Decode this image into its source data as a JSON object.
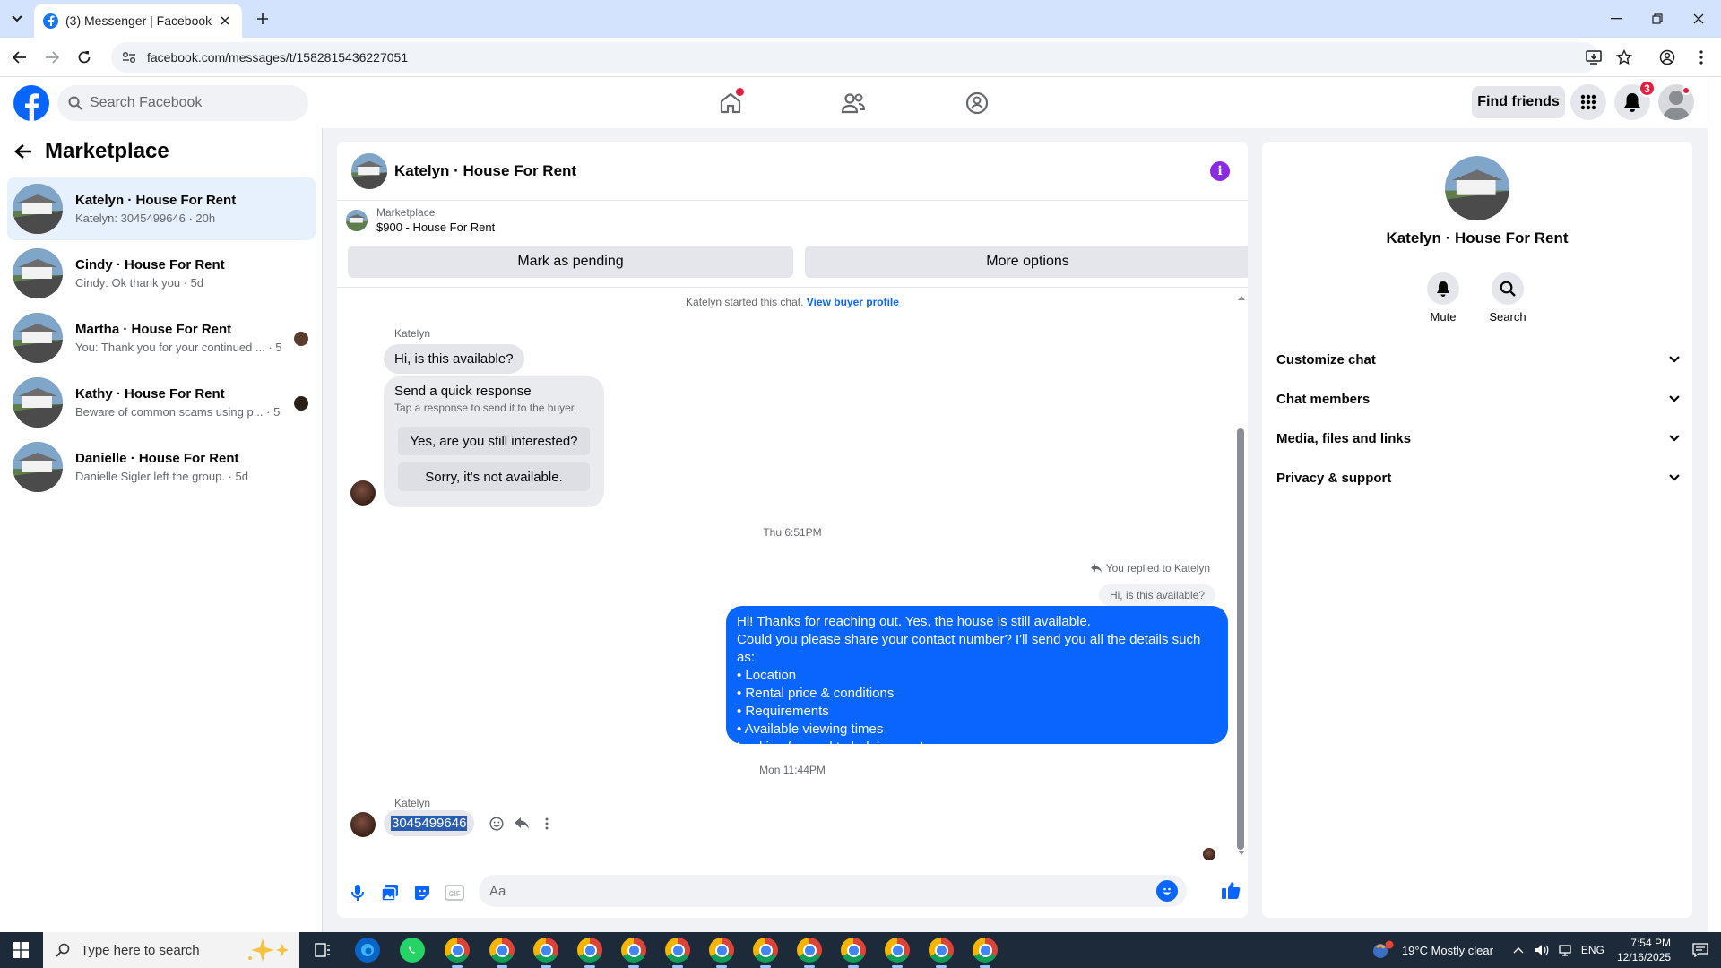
{
  "browser": {
    "tab_title": "(3) Messenger | Facebook",
    "url": "facebook.com/messages/t/1582815436227051"
  },
  "fb": {
    "search_placeholder": "Search Facebook",
    "find_friends": "Find friends",
    "notification_count": "3"
  },
  "left": {
    "title": "Marketplace",
    "conversations": [
      {
        "name": "Katelyn · House For Rent",
        "preview": "Katelyn: 3045499646 · 20h"
      },
      {
        "name": "Cindy · House For Rent",
        "preview": "Cindy: Ok thank you · 5d"
      },
      {
        "name": "Martha · House For Rent",
        "preview": "You: Thank you for your continued ... · 5d"
      },
      {
        "name": "Kathy · House For Rent",
        "preview": "Beware of common scams using p... · 5d"
      },
      {
        "name": "Danielle · House For Rent",
        "preview": "Danielle Sigler left the group. · 5d"
      }
    ]
  },
  "chat": {
    "title": "Katelyn · House For Rent",
    "listing_label": "Marketplace",
    "listing_title": "$900 - House For Rent",
    "mark_pending": "Mark as pending",
    "more_options": "More options",
    "started_text": "Katelyn started this chat.",
    "view_buyer": "View buyer profile",
    "sender": "Katelyn",
    "msg1": "Hi, is this available?",
    "quick_title": "Send a quick response",
    "quick_sub": "Tap a response to send it to the buyer.",
    "quick1": "Yes, are you still interested?",
    "quick2": "Sorry, it's not available.",
    "time1": "Thu 6:51PM",
    "replied_label": "You replied to Katelyn",
    "replied_quote": "Hi, is this available?",
    "out_lines": [
      "Hi! Thanks for reaching out. Yes, the house is still available.",
      "Could you please share your contact number? I'll send you all the details such as:",
      "• Location",
      "• Rental price & conditions",
      "• Requirements",
      "• Available viewing times",
      "Looking forward to helping you!"
    ],
    "time2": "Mon 11:44PM",
    "phone": "3045499646",
    "input_placeholder": "Aa"
  },
  "right": {
    "name": "Katelyn · House For Rent",
    "mute": "Mute",
    "search": "Search",
    "rows": [
      "Customize chat",
      "Chat members",
      "Media, files and links",
      "Privacy & support"
    ]
  },
  "taskbar": {
    "search_placeholder": "Type here to search",
    "weather": "19°C  Mostly clear",
    "lang": "ENG",
    "time": "7:54 PM",
    "date": "12/16/2025"
  },
  "colors": {
    "brand": "#0866ff",
    "badge": "#e41e3f"
  }
}
